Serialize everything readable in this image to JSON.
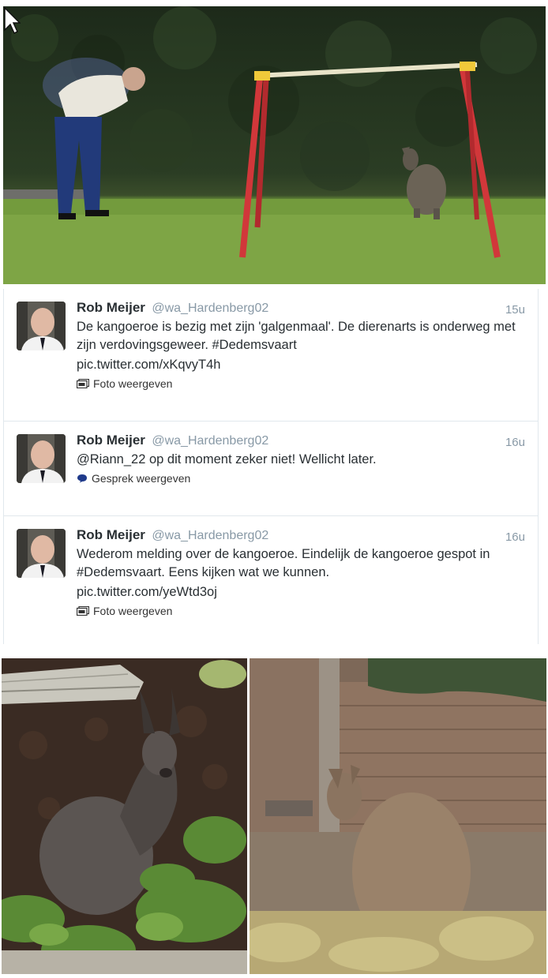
{
  "tweets": [
    {
      "name": "Rob Meijer",
      "handle": "@wa_Hardenberg02",
      "time": "15u",
      "text": "De kangoeroe is bezig met zijn 'galgenmaal'. De dierenarts is onderweg met zijn verdovingsgeweer. #Dedemsvaart",
      "link": "pic.twitter.com/xKqvyT4h",
      "action": "Foto weergeven",
      "action_icon": "photo-icon"
    },
    {
      "name": "Rob Meijer",
      "handle": "@wa_Hardenberg02",
      "time": "16u",
      "text": "@Riann_22 op dit moment zeker niet! Wellicht later.",
      "link": "",
      "action": "Gesprek weergeven",
      "action_icon": "speech-bubble-icon"
    },
    {
      "name": "Rob Meijer",
      "handle": "@wa_Hardenberg02",
      "time": "16u",
      "text": "Wederom melding over de kangoeroe. Eindelijk de kangoeroe gespot in #Dedemsvaart. Eens kijken wat we kunnen.",
      "link": "pic.twitter.com/yeWtd3oj",
      "action": "Foto weergeven",
      "action_icon": "photo-icon"
    }
  ],
  "colors": {
    "twitter_text": "#292f33",
    "twitter_muted": "#8899a6",
    "border": "#e1e8ed"
  }
}
